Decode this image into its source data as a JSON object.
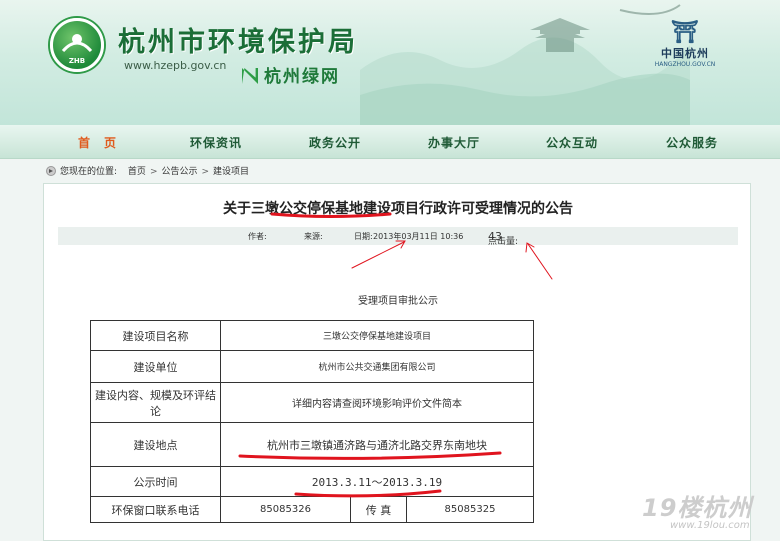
{
  "header": {
    "site_title": "杭州市环境保护局",
    "site_url": "www.hzepb.gov.cn",
    "green_net": "杭州绿网",
    "seal_text": "ZHB",
    "right_logo_cn": "中国杭州",
    "right_logo_en": "HANGZHOU.GOV.CN"
  },
  "nav": {
    "items": [
      "首　页",
      "环保资讯",
      "政务公开",
      "办事大厅",
      "公众互动",
      "公众服务"
    ]
  },
  "breadcrumb": {
    "prefix": "您现在的位置:",
    "items": [
      "首页",
      "公告公示",
      "建设项目"
    ],
    "separator": ">"
  },
  "article": {
    "title": "关于三墩公交停保基地建设项目行政许可受理情况的公告",
    "meta": {
      "author_label": "作者:",
      "source_label": "来源:",
      "date_label": "日期:",
      "date_value": "2013年03月11日  10:36",
      "clicks_label": "点击量:",
      "clicks_value": "43"
    },
    "sub_heading": "受理项目审批公示",
    "table": {
      "rows": [
        {
          "label": "建设项目名称",
          "value": "三墩公交停保基地建设项目"
        },
        {
          "label": "建设单位",
          "value": "杭州市公共交通集团有限公司"
        },
        {
          "label": "建设内容、规模及环评结论",
          "value": "详细内容请查阅环境影响评价文件简本"
        },
        {
          "label": "建设地点",
          "value": "杭州市三墩镇通济路与通济北路交界东南地块"
        },
        {
          "label": "公示时间",
          "value": "2013.3.11～2013.3.19"
        }
      ],
      "phone_row": {
        "label": "环保窗口联系电话",
        "phone": "85085326",
        "fax_label": "传 真",
        "fax": "85085325"
      }
    }
  },
  "watermark": {
    "brand": "19楼杭州",
    "url": "www.19lou.com"
  },
  "colors": {
    "brand_green": "#1b6e37",
    "nav_active": "#e05a1d",
    "annotation_red": "#e0141e"
  }
}
